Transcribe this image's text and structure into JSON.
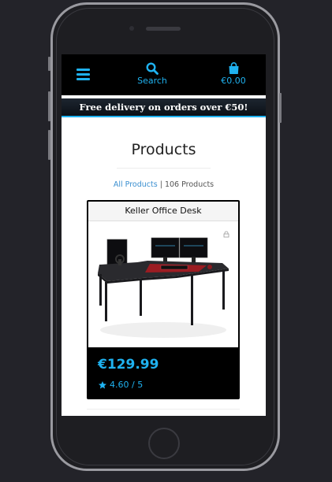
{
  "navbar": {
    "search_label": "Search",
    "cart_total": "€0.00"
  },
  "banner": {
    "text": "Free delivery on orders over €50!"
  },
  "page": {
    "title": "Products",
    "breadcrumb_link": "All Products",
    "separator": "|",
    "product_count": "106 Products"
  },
  "product": {
    "name": "Keller Office Desk",
    "price": "€129.99",
    "rating": "4.60 / 5"
  },
  "colors": {
    "accent": "#1fb2f0",
    "navbar_bg": "#000000",
    "page_bg": "#ffffff"
  },
  "icons": [
    "menu-icon",
    "search-icon",
    "shopping-bag-icon",
    "star-icon"
  ]
}
